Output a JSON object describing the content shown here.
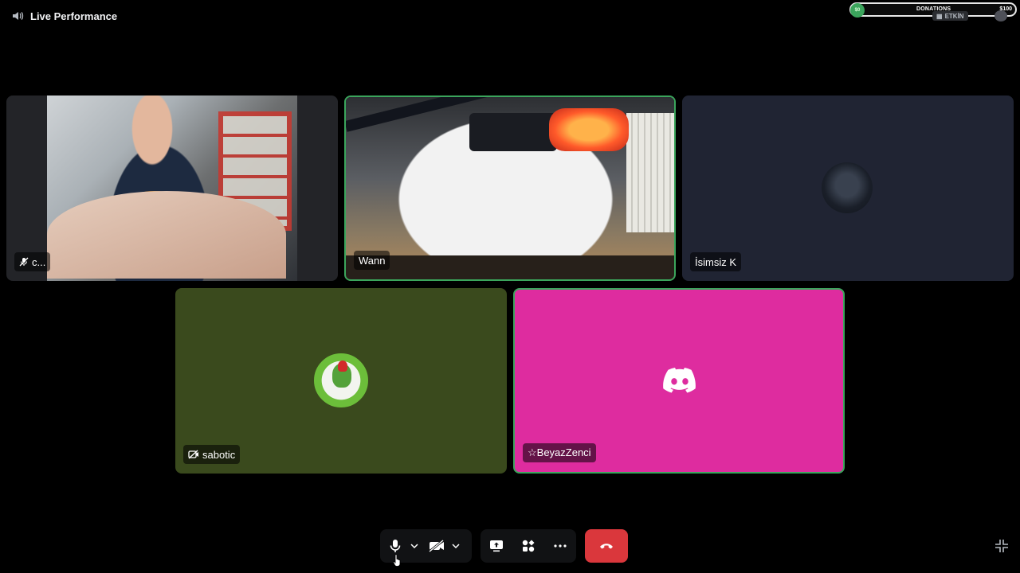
{
  "window": {
    "title": "Live Performance"
  },
  "widget": {
    "donations_label": "DONATIONS",
    "donations_amount": "$100",
    "avatar_text": "$0",
    "status_badge": "ETKİN"
  },
  "participants": [
    {
      "name": "c...",
      "muted": true
    },
    {
      "name": "Wann",
      "speaking": true
    },
    {
      "name": "İsimsiz K"
    },
    {
      "name": "sabotic",
      "camera_off": true
    },
    {
      "name": "☆BeyazZenci",
      "speaking": true
    }
  ],
  "colors": {
    "speaking_border": "#3ba55c",
    "end_call": "#da373c",
    "sabotic_bg": "#3a4a1d",
    "beyaz_bg": "#de2c9f",
    "isimsiz_bg": "#202433"
  },
  "controls": [
    "microphone",
    "microphone-options",
    "camera",
    "camera-options",
    "screen-share",
    "activities",
    "more",
    "end-call"
  ]
}
